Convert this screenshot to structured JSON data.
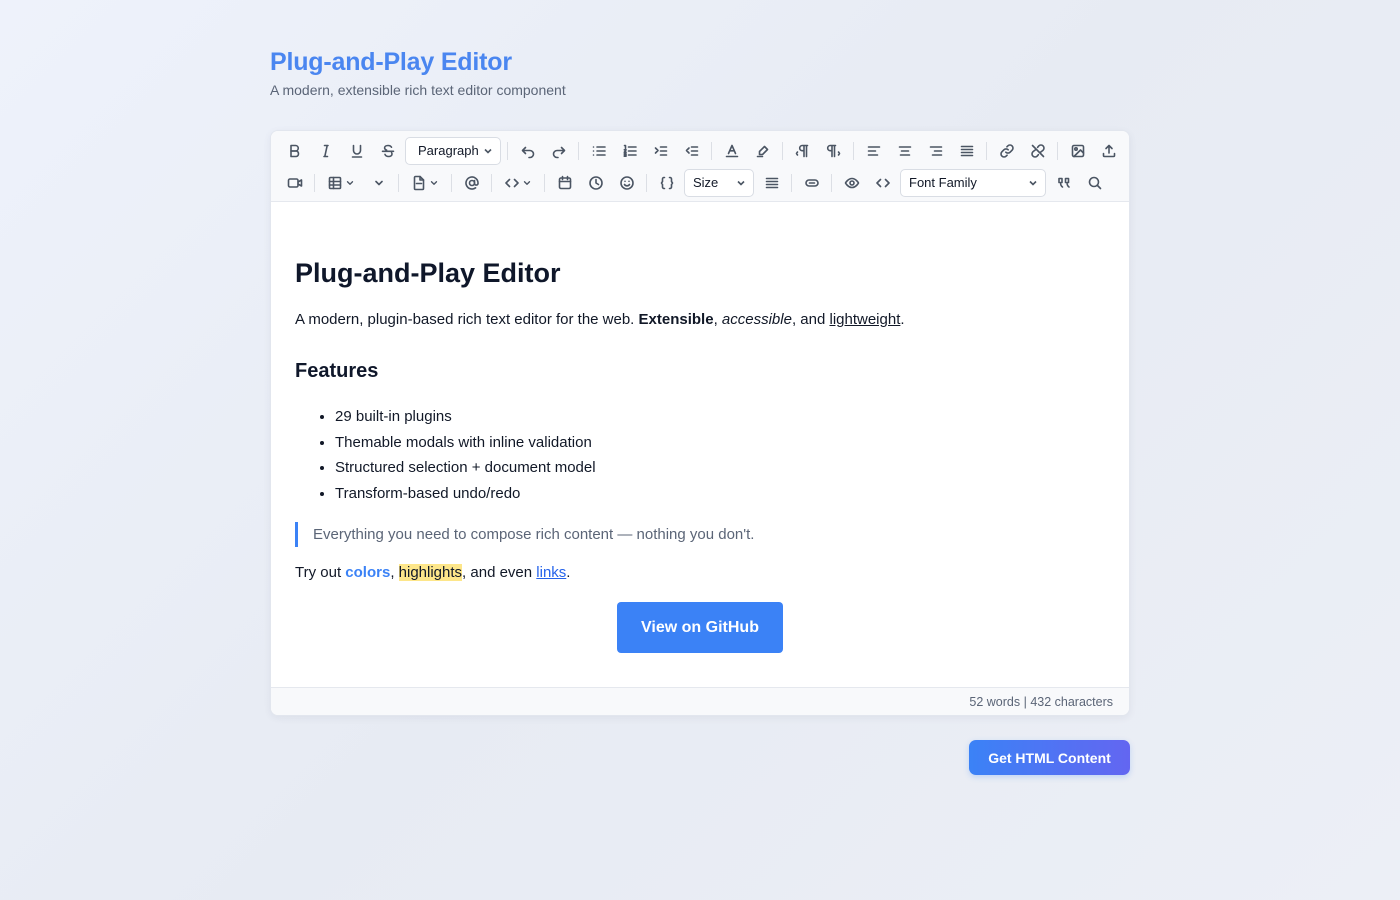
{
  "header": {
    "title": "Plug-and-Play Editor",
    "subtitle": "A modern, extensible rich text editor component"
  },
  "toolbar": {
    "row1": [
      "bold-icon",
      "italic-icon",
      "underline-icon",
      "strikethrough-icon",
      "paragraph-select",
      "undo-icon",
      "redo-icon",
      "bullet-list-icon",
      "numbered-list-icon",
      "indent-icon",
      "outdent-icon",
      "text-color-icon",
      "highlight-icon",
      "ltr-icon",
      "rtl-icon",
      "align-left-icon",
      "align-center-icon",
      "align-right-icon",
      "justify-icon",
      "link-icon",
      "unlink-icon",
      "image-icon",
      "upload-icon"
    ],
    "row2": [
      "video-icon",
      "table-icon",
      "chevron-icon",
      "file-icon",
      "mention-icon",
      "code-icon",
      "calendar-icon",
      "clock-icon",
      "emoji-icon",
      "braces-icon",
      "size-select",
      "line-height-icon",
      "embed-icon",
      "preview-icon",
      "source-code-icon",
      "font-family-select",
      "quote-icon",
      "search-icon"
    ],
    "block_format": "Paragraph",
    "size_placeholder": "Size",
    "font_family_placeholder": "Font Family"
  },
  "document": {
    "heading": "Plug-and-Play Editor",
    "intro": {
      "before": "A modern, plugin-based rich text editor for the web. ",
      "bold": "Extensible",
      "comma1": ", ",
      "italic": "accessible",
      "and": ", and ",
      "underlined": "lightweight",
      "end": "."
    },
    "features_heading": "Features",
    "features": [
      "29 built-in plugins",
      "Themable modals with inline validation",
      "Structured selection + document model",
      "Transform-based undo/redo"
    ],
    "quote": "Everything you need to compose rich content — nothing you don't.",
    "try": {
      "before": "Try out ",
      "colors": "colors",
      "comma": ", ",
      "highlights": "highlights",
      "mid": ", and even ",
      "links": "links",
      "end": "."
    },
    "github_button": "View on GitHub"
  },
  "status": {
    "words": "52 words",
    "divider": " | ",
    "characters": "432 characters"
  },
  "actions": {
    "get_html": "Get HTML Content"
  },
  "colors": {
    "accent": "#3b82f6",
    "title": "#4a86f0",
    "highlight": "#fde68a"
  }
}
